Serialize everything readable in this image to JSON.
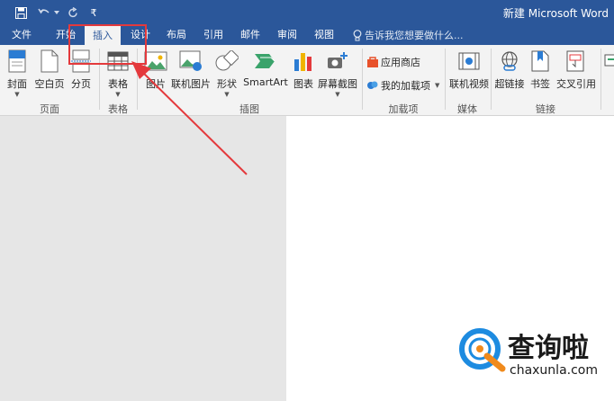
{
  "window": {
    "title": "新建 Microsoft Word"
  },
  "quick_access": {
    "customize": "₹"
  },
  "tabs": [
    {
      "label": "文件"
    },
    {
      "label": "开始"
    },
    {
      "label": "插入"
    },
    {
      "label": "设计"
    },
    {
      "label": "布局"
    },
    {
      "label": "引用"
    },
    {
      "label": "邮件"
    },
    {
      "label": "审阅"
    },
    {
      "label": "视图"
    }
  ],
  "tell_me": {
    "placeholder": "告诉我您想要做什么..."
  },
  "ribbon": {
    "buttons": {
      "cover": "封面",
      "blank_page": "空白页",
      "page_break": "分页",
      "table": "表格",
      "picture": "图片",
      "online_picture": "联机图片",
      "shapes": "形状",
      "smartart": "SmartArt",
      "chart": "图表",
      "screenshot": "屏幕截图",
      "store": "应用商店",
      "my_addins": "我的加载项",
      "online_video": "联机视频",
      "hyperlink": "超链接",
      "bookmark": "书签",
      "cross_ref": "交叉引用"
    },
    "groups": {
      "pages": "页面",
      "tables": "表格",
      "illustrations": "插图",
      "addins": "加载项",
      "media": "媒体",
      "links": "链接"
    }
  },
  "colors": {
    "accent": "#2b579a",
    "highlight": "#e4393c",
    "logo_blue": "#1d8be0",
    "logo_orange": "#f08a1c"
  },
  "watermark": {
    "brand": "查询啦",
    "url": "chaxunla.com"
  }
}
